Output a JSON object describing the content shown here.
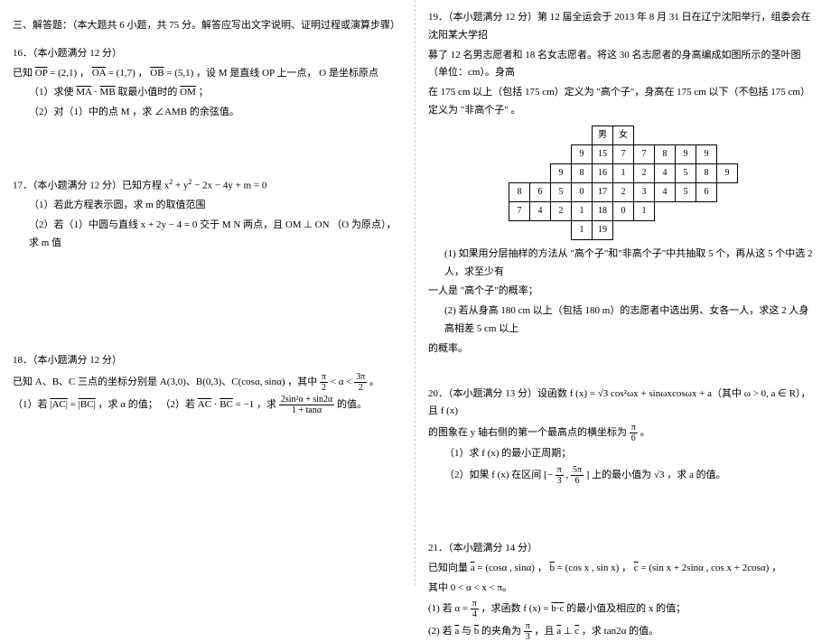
{
  "left": {
    "section": "三、解答题：（本大题共 6 小题，共 75 分。解答应写出文字说明、证明过程或演算步骤）",
    "q16": {
      "head": "16．（本小题满分 12 分）",
      "l1a": "已知 ",
      "op": "OP",
      "opv": " = (2,1) ，",
      "oa": "OA",
      "oav": " = (1,7) ，",
      "ob": "OB",
      "obv": " = (5,1) ，设 M 是直线 OP 上一点， O 是坐标原点",
      "l2a": "（1）求使 ",
      "ma": "MA",
      "dot": " ·",
      "mb": "MB",
      "l2b": " 取最小值时的 ",
      "om": "OM",
      "l2c": "；",
      "l3": "（2）对（1）中的点 M ，求 ∠AMB 的余弦值。"
    },
    "q17": {
      "head": "17．（本小题满分 12 分）已知方程  x",
      "eq": " + y",
      "eq2": " − 2x − 4y + m = 0",
      "l1": "（1）若此方程表示圆，求  m 的取值范围",
      "l2": "（2）若（1）中圆与直线  x + 2y − 4 = 0 交于 M  N 两点，且 OM ⊥ ON （O 为原点），求 m 值"
    },
    "q18": {
      "head": "18．（本小题满分 12 分）",
      "l1a": "已知 A、B、C 三点的坐标分别是  A(3,0)、B(0,3)、C(cosα, sinα) ，其中 ",
      "fr1n": "π",
      "fr1d": "2",
      "l1b": " < α < ",
      "fr2n": "3π",
      "fr2d": "2",
      "l1c": "。",
      "l2a": "（1）若 ",
      "ac": "|AC|",
      "eq1": " = ",
      "bc": "|BC|",
      "l2b": " ，求 α 的值；   （2）若 ",
      "ac2": "AC",
      "dot2": "·",
      "bc2": "BC",
      "l2c": " = −1 ，求 ",
      "fr3n": "2sin²α + sin2α",
      "fr3d": "1 + tanα",
      "l2d": " 的值。"
    }
  },
  "right": {
    "q19": {
      "l1": "19．（本小题满分 12 分）第 12 届全运会于 2013 年 8 月 31 日在辽宁沈阳举行，组委会在沈阳某大学招",
      "l2": "募了 12 名男志愿者和 18 名女志愿者。将这 30 名志愿者的身高编成如图所示的茎叶图  （单位：cm）。身高",
      "l3": "在 175 cm 以上（包括 175 cm）定义为 \"高个子\"，身高在  175 cm 以下（不包括 175 cm）定义为 \"非高个子\" 。",
      "thm": "男",
      "thf": "女",
      "p1": "(1) 如果用分层抽样的方法从  \"高个子\"和\"非高个子\"中共抽取 5 个，再从这 5 个中选 2 人，求至少有",
      "p1b": "一人是 \"高个子\"的概率；",
      "p2": "(2) 若从身高  180 cm 以上（包括 180 m）的志愿者中选出男、女各一人，求这   2 人身高相差  5 cm 以上",
      "p2b": "的概率。"
    },
    "q20": {
      "head": "20．（本小题满分  13 分）设函数  f (x) = √3 cos²ωx + sinωxcosωx + a（其中 ω > 0, a ∈ R），且 f (x)",
      "l1a": "的图象在  y 轴右侧的第一个最高点的横坐标为  ",
      "frn": "π",
      "frd": "6",
      "l1b": "。",
      "l2": "（1）求 f (x) 的最小正周期；",
      "l3a": "（2）如果 f (x) 在区间 ",
      "brL": "[−",
      "f2n": "π",
      "f2d": "3",
      "com": ", ",
      "f3n": "5π",
      "f3d": "6",
      "brR": "]",
      "l3b": " 上的最小值为  √3 ，求 a 的值。"
    },
    "q21": {
      "head": "21．（本小题满分  14 分）",
      "l1a": "已知向量  ",
      "va": "a",
      "l1b": " = (cosα , sinα) ， ",
      "vb": "b",
      "l1c": " = (cos x , sin x) ， ",
      "vc": "c",
      "l1d": " = (sin x + 2sinα , cos x + 2cosα) ，",
      "l2": "其中 0 < α < x < π。",
      "l3a": "(1) 若 α = ",
      "f1n": "π",
      "f1d": "4",
      "l3b": " ，求函数  f (x) = ",
      "bic": "b·c",
      "l3c": " 的最小值及相应的   x 的值；",
      "l4a": "(2) 若 ",
      "va2": "a",
      "and": " 与 ",
      "vb2": "b",
      "l4b": " 的夹角为 ",
      "f2n": "π",
      "f2d": "3",
      "l4c": "，且 ",
      "va3": "a",
      "perp": " ⊥ ",
      "vc2": "c",
      "l4d": "，求 tan2α 的值。"
    }
  },
  "chart_data": {
    "type": "table",
    "title": "stem-and-leaf plot of heights",
    "columns": [
      "男 leaves (right-to-left)",
      "stem",
      "女 leaves"
    ],
    "rows": [
      [
        "9",
        "15",
        "7 7 8 9 9"
      ],
      [
        "9 8",
        "16",
        "1 2 4 5 8 9"
      ],
      [
        "8 6 5 0",
        "17",
        "2 3 4 5 6"
      ],
      [
        "7 4 2 1",
        "18",
        "0 1"
      ],
      [
        "1",
        "19",
        ""
      ]
    ]
  }
}
